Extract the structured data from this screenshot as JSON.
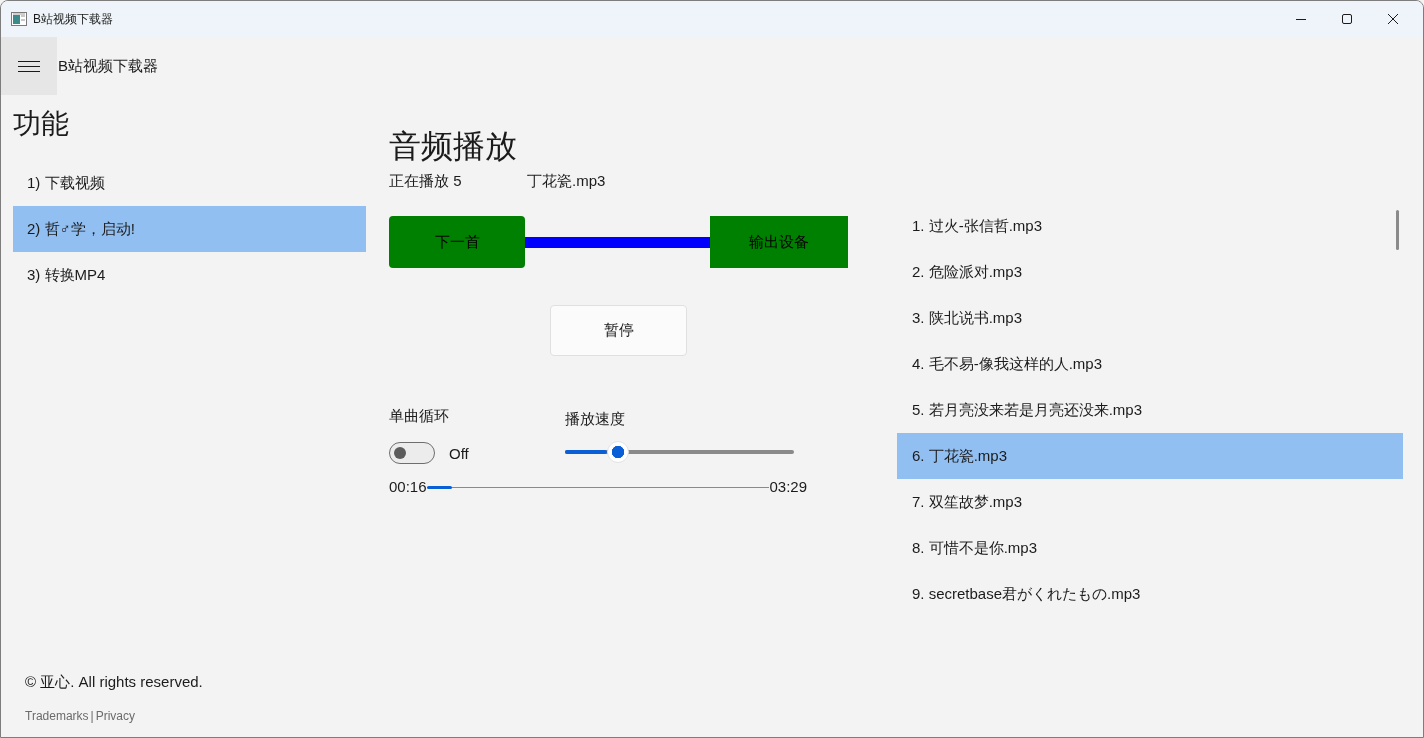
{
  "window": {
    "title": "B站视频下载器"
  },
  "app_bar": {
    "title": "B站视频下载器"
  },
  "sidebar": {
    "heading": "功能",
    "items": [
      {
        "label": "1) 下载视频",
        "selected": false
      },
      {
        "label": "2) 哲♂学，启动!",
        "selected": true
      },
      {
        "label": "3) 转换MP4",
        "selected": false
      }
    ]
  },
  "footer": {
    "copyright": "© 亚心. All rights reserved.",
    "links": [
      "Trademarks",
      "Privacy"
    ],
    "separator": "|"
  },
  "player": {
    "heading": "音频播放",
    "now_playing_label": "正在播放 5",
    "now_playing_file": "丁花瓷.mp3",
    "next_button": "下一首",
    "output_button": "输出设备",
    "pause_button": "暂停",
    "loop": {
      "label": "单曲循环",
      "on": false,
      "state_text": "Off"
    },
    "speed": {
      "label": "播放速度",
      "level": 0.23
    },
    "progress": {
      "elapsed": "00:16",
      "total": "03:29",
      "level": 0.075
    }
  },
  "playlist": {
    "items": [
      {
        "label": "1. 过火-张信哲.mp3",
        "selected": false
      },
      {
        "label": "2. 危险派对.mp3",
        "selected": false
      },
      {
        "label": "3. 陕北说书.mp3",
        "selected": false
      },
      {
        "label": "4. 毛不易-像我这样的人.mp3",
        "selected": false
      },
      {
        "label": "5. 若月亮没来若是月亮还没来.mp3",
        "selected": false
      },
      {
        "label": "6. 丁花瓷.mp3",
        "selected": true
      },
      {
        "label": "7. 双笙故梦.mp3",
        "selected": false
      },
      {
        "label": "8. 可惜不是你.mp3",
        "selected": false
      },
      {
        "label": "9. secretbase君がくれたもの.mp3",
        "selected": false
      }
    ]
  }
}
